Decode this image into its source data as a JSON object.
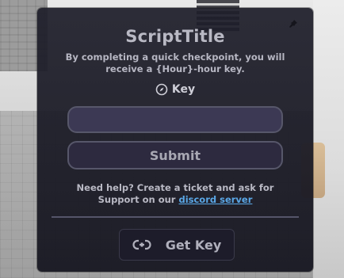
{
  "panel": {
    "title": "ScriptTitle",
    "subtitle": "By completing a quick checkpoint, you will receive a {Hour}-hour key.",
    "key_label": "Key",
    "key_input": {
      "value": "",
      "placeholder": ""
    },
    "submit_label": "Submit",
    "help_text": "Need help? Create a ticket and ask for Support on our",
    "help_link": "discord server",
    "getkey_label": "Get Key"
  },
  "icons": {
    "key_icon": "compass-icon",
    "getkey_icon": "link-icon",
    "drag_icon": "pin-icon"
  },
  "colors": {
    "panel_bg": "#1e1e2a",
    "input_bg": "#3c3954",
    "link": "#5aa7e6"
  }
}
